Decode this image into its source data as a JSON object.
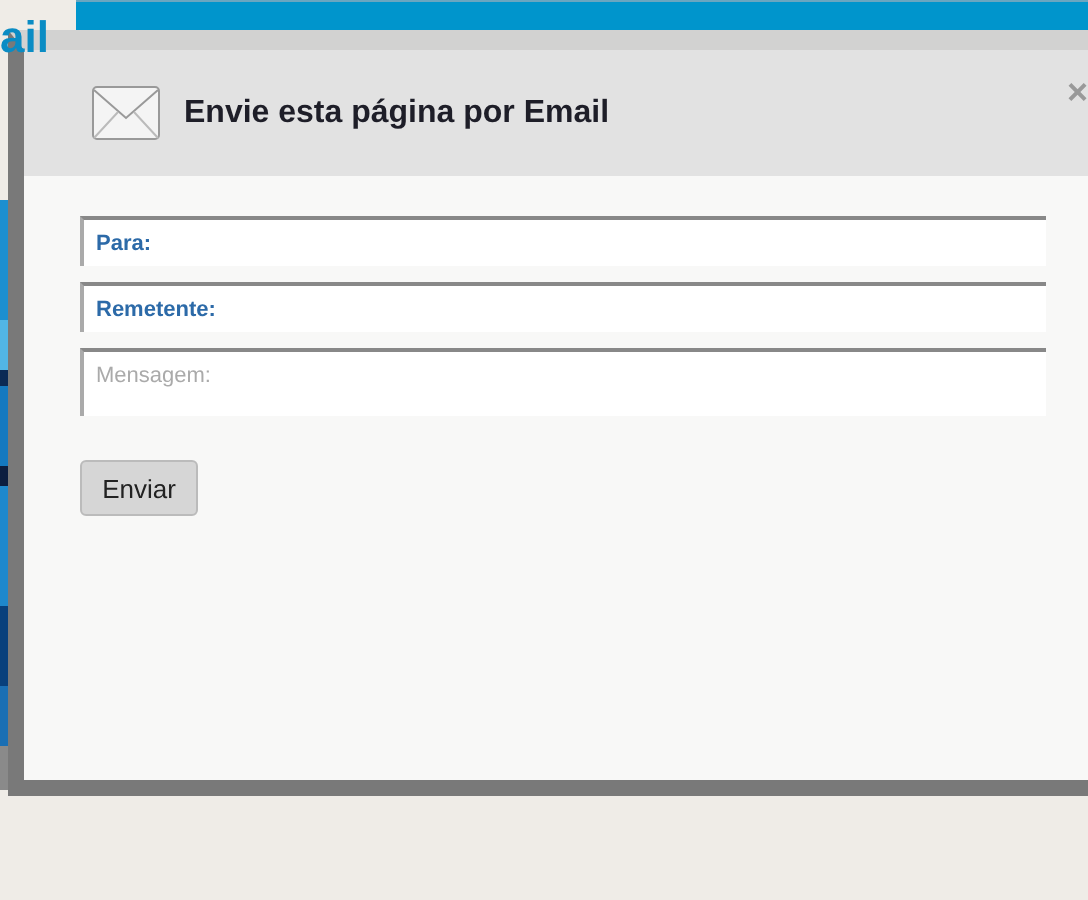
{
  "site": {
    "logo_fragment": "ail"
  },
  "dialog": {
    "title": "Envie esta página por Email",
    "close": "×",
    "fields": [
      {
        "kind": "input",
        "placeholder": "Para:"
      },
      {
        "kind": "input",
        "placeholder": "Remetente:"
      },
      {
        "kind": "textarea",
        "placeholder": "Mensagem:"
      }
    ],
    "submit": "Enviar"
  }
}
